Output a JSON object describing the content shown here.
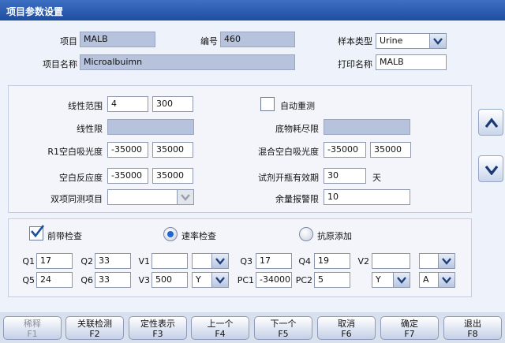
{
  "window": {
    "title": "项目参数设置"
  },
  "header": {
    "item_label": "项目",
    "item_value": "MALB",
    "code_label": "编号",
    "code_value": "460",
    "name_label": "项目名称",
    "name_value": "Microalbuimn",
    "sample_type_label": "样本类型",
    "sample_type_value": "Urine",
    "print_name_label": "打印名称",
    "print_name_value": "MALB"
  },
  "params": {
    "linear_range_label": "线性范围",
    "linear_range_min": "4",
    "linear_range_max": "300",
    "linear_limit_label": "线性限",
    "linear_limit_value": "",
    "r1_blank_label": "R1空白吸光度",
    "r1_blank_min": "-35000",
    "r1_blank_max": "35000",
    "blank_reaction_label": "空白反应度",
    "blank_reaction_min": "-35000",
    "blank_reaction_max": "35000",
    "dual_item_label": "双项同测项目",
    "dual_item_value": "",
    "auto_rerun_label": "自动重测",
    "auto_rerun_checked": false,
    "substrate_label": "底物耗尽限",
    "substrate_value": "",
    "mix_blank_label": "混合空白吸光度",
    "mix_blank_min": "-35000",
    "mix_blank_max": "35000",
    "reagent_valid_label": "试剂开瓶有效期",
    "reagent_valid_value": "30",
    "reagent_valid_unit": "天",
    "remain_alarm_label": "余量报警限",
    "remain_alarm_value": "10"
  },
  "checks": {
    "prezone_label": "前带检查",
    "prezone_checked": true,
    "rate_label": "速率检查",
    "rate_selected": true,
    "antigen_label": "抗原添加",
    "antigen_selected": false
  },
  "coeffs": {
    "q1_label": "Q1",
    "q1": "17",
    "q2_label": "Q2",
    "q2": "33",
    "v1_label": "V1",
    "v1": "",
    "v1_sel": "",
    "q3_label": "Q3",
    "q3": "17",
    "q4_label": "Q4",
    "q4": "19",
    "v2_label": "V2",
    "v2": "",
    "v2_sel": "",
    "q5_label": "Q5",
    "q5": "24",
    "q6_label": "Q6",
    "q6": "33",
    "v3_label": "V3",
    "v3": "500",
    "v3_sel": "Y",
    "pc1_label": "PC1",
    "pc1": "-34000",
    "pc2_label": "PC2",
    "pc2": "5",
    "pc2_sel": "Y",
    "last_sel": "A"
  },
  "footer": {
    "b1": {
      "label": "稀释",
      "key": "F1"
    },
    "b2": {
      "label": "关联检测",
      "key": "F2"
    },
    "b3": {
      "label": "定性表示",
      "key": "F3"
    },
    "b4": {
      "label": "上一个",
      "key": "F4"
    },
    "b5": {
      "label": "下一个",
      "key": "F5"
    },
    "b6": {
      "label": "取消",
      "key": "F6"
    },
    "b7": {
      "label": "确定",
      "key": "F7"
    },
    "b8": {
      "label": "退出",
      "key": "F8"
    }
  },
  "colors": {
    "titlebar": "#2a5bb0",
    "readonly_field": "#b7c3dc",
    "radio_selected": "#1e66d2"
  },
  "icons": {
    "up": "up-arrow-icon",
    "down": "down-arrow-icon",
    "dropdown": "chevron-down-icon",
    "check": "checkmark-icon"
  }
}
